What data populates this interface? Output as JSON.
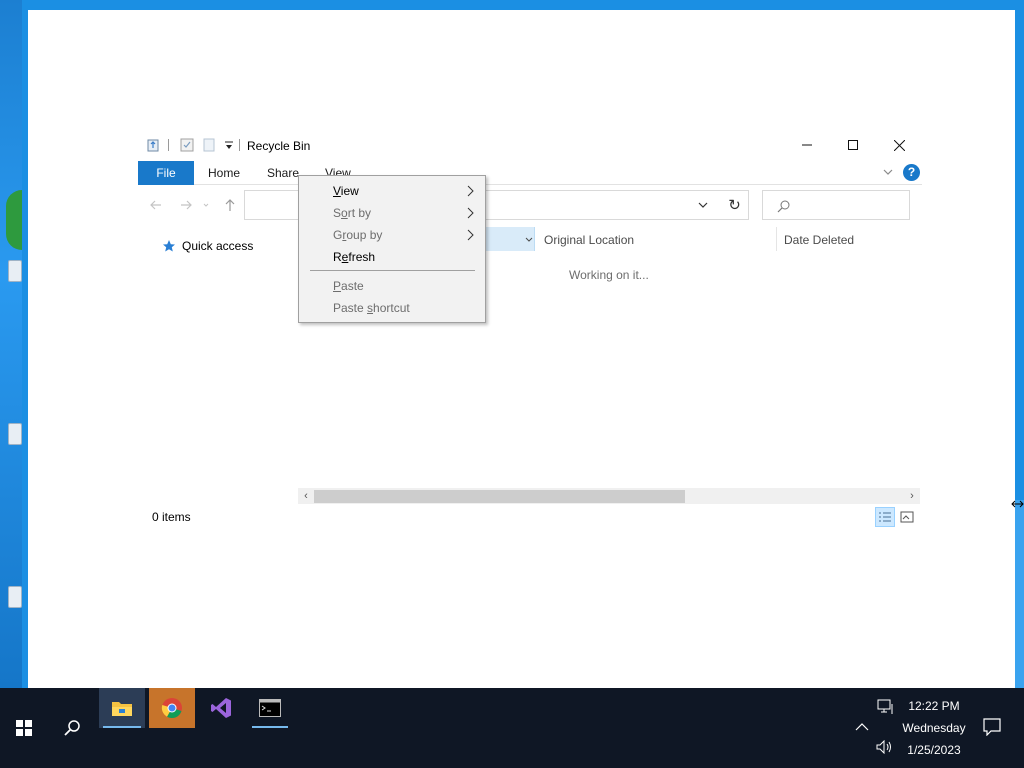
{
  "window": {
    "title": "Recycle Bin",
    "minimize_label": "Minimize",
    "maximize_label": "Maximize",
    "close_label": "Close"
  },
  "ribbon": {
    "tabs": [
      "File",
      "Home",
      "Share",
      "View"
    ],
    "help_label": "?"
  },
  "navigation": {
    "address_value": "",
    "search_placeholder": ""
  },
  "nav_pane": {
    "quick_access": "Quick access"
  },
  "columns": {
    "original_location": "Original Location",
    "date_deleted": "Date Deleted"
  },
  "content": {
    "working_text": "Working on it..."
  },
  "status": {
    "item_count": "0 items"
  },
  "context_menu": {
    "view": "View",
    "sort_by": "Sort by",
    "group_by": "Group by",
    "refresh": "Refresh",
    "paste": "Paste",
    "paste_shortcut": "Paste shortcut"
  },
  "taskbar": {
    "time": "12:22 PM",
    "day": "Wednesday",
    "date": "1/25/2023"
  },
  "colors": {
    "accent": "#1979ca",
    "desktop": "#1b8fe3",
    "taskbar": "#0f1725"
  }
}
